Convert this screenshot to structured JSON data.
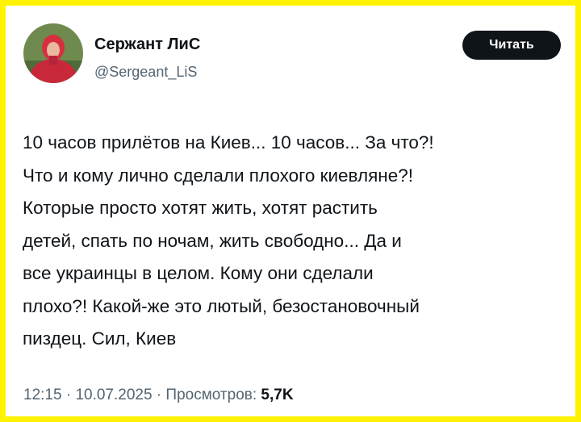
{
  "author": {
    "display_name": "Сержант ЛиС",
    "handle": "@Sergeant_LiS"
  },
  "follow_button": {
    "label": "Читать"
  },
  "post": {
    "lines": [
      "10 часов прилётов на Киев... 10 часов... За что?!",
      "Что и кому лично сделали плохого киевляне?!",
      "Которые просто хотят жить, хотят растить",
      "детей, спать по ночам, жить свободно... Да и",
      "все украинцы в целом. Кому они сделали",
      "плохо?! Какой-же это лютый, безостановочный",
      "пиздец. Сил, Киев"
    ]
  },
  "meta": {
    "time": "12:15",
    "separator": " · ",
    "date": "10.07.2025",
    "views_label": "Просмотров:",
    "views_count": "5,7K"
  },
  "colors": {
    "border": "#fff200",
    "background": "#ffffff",
    "text_primary": "#0f1419",
    "text_secondary": "#536471",
    "button_background": "#0f1419"
  }
}
